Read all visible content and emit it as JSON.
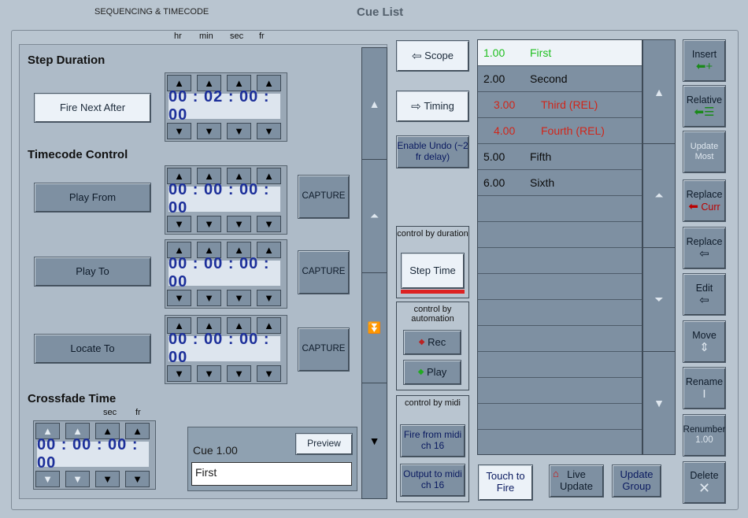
{
  "header": {
    "section_tab": "SEQUENCING & TIMECODE",
    "title": "Cue List"
  },
  "units": {
    "hr": "hr",
    "min": "min",
    "sec": "sec",
    "fr": "fr"
  },
  "step_duration": {
    "heading": "Step Duration",
    "button": "Fire Next After",
    "value": "00 : 02 : 00 : 00"
  },
  "timecode_control": {
    "heading": "Timecode Control",
    "rows": [
      {
        "button": "Play From",
        "value": "00 : 00 : 00 : 00",
        "capture": "CAPTURE"
      },
      {
        "button": "Play To",
        "value": "00 : 00 : 00 : 00",
        "capture": "CAPTURE"
      },
      {
        "button": "Locate To",
        "value": "00 : 00 : 00 : 00",
        "capture": "CAPTURE"
      }
    ]
  },
  "crossfade": {
    "heading": "Crossfade Time",
    "sec": "sec",
    "fr": "fr",
    "value": "00 : 00 : 00 : 00"
  },
  "selected_cue": {
    "label": "Cue 1.00",
    "preview": "Preview",
    "name": "First"
  },
  "middle": {
    "scope": "Scope",
    "timing": "Timing",
    "enable_undo": "Enable Undo (~2 fr delay)",
    "duration_title": "control by duration",
    "step_time": "Step Time",
    "automation_title": "control by automation",
    "rec": "Rec",
    "play": "Play",
    "midi_title": "control by midi",
    "fire_midi": "Fire from midi ch 16",
    "output_midi": "Output to midi ch 16"
  },
  "cues": [
    {
      "num": "1.00",
      "name": "First"
    },
    {
      "num": "2.00",
      "name": "Second"
    },
    {
      "num": "3.00",
      "name": "Third (REL)"
    },
    {
      "num": "4.00",
      "name": "Fourth (REL)"
    },
    {
      "num": "5.00",
      "name": "Fifth"
    },
    {
      "num": "6.00",
      "name": "Sixth"
    }
  ],
  "bottom": {
    "touch": "Touch to Fire",
    "live": "Live Update",
    "group": "Update Group"
  },
  "right": {
    "insert": "Insert",
    "relative": "Relative",
    "update": "Update",
    "most": "Most",
    "replace_curr": "Replace",
    "curr": "Curr",
    "replace": "Replace",
    "edit": "Edit",
    "move": "Move",
    "rename": "Rename",
    "renumber": "Renumber",
    "renumber_val": "1.00",
    "delete": "Delete"
  },
  "colors": {
    "green_cue": "#1fbf1f",
    "red_cue": "#d0261a",
    "tc_blue": "#1c2f9a"
  }
}
